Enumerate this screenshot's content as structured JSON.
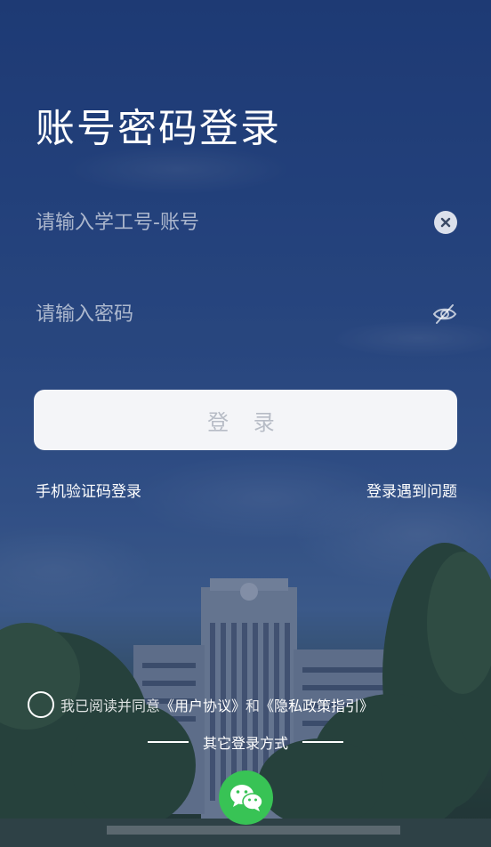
{
  "title": "账号密码登录",
  "username": {
    "placeholder": "请输入学工号-账号",
    "value": ""
  },
  "password": {
    "placeholder": "请输入密码",
    "value": ""
  },
  "login_button": "登 录",
  "links": {
    "sms_login": "手机验证码登录",
    "trouble": "登录遇到问题"
  },
  "agreement": {
    "prefix": "我已阅读并同意",
    "user_agreement": "《用户协议》",
    "and": "和",
    "privacy_policy": "《隐私政策指引》",
    "checked": false
  },
  "other_login": "其它登录方式",
  "other_methods": [
    "wechat-icon"
  ],
  "colors": {
    "wechat": "#38c355",
    "button_bg": "#f4f5f8",
    "button_text": "#b7bcc6"
  }
}
